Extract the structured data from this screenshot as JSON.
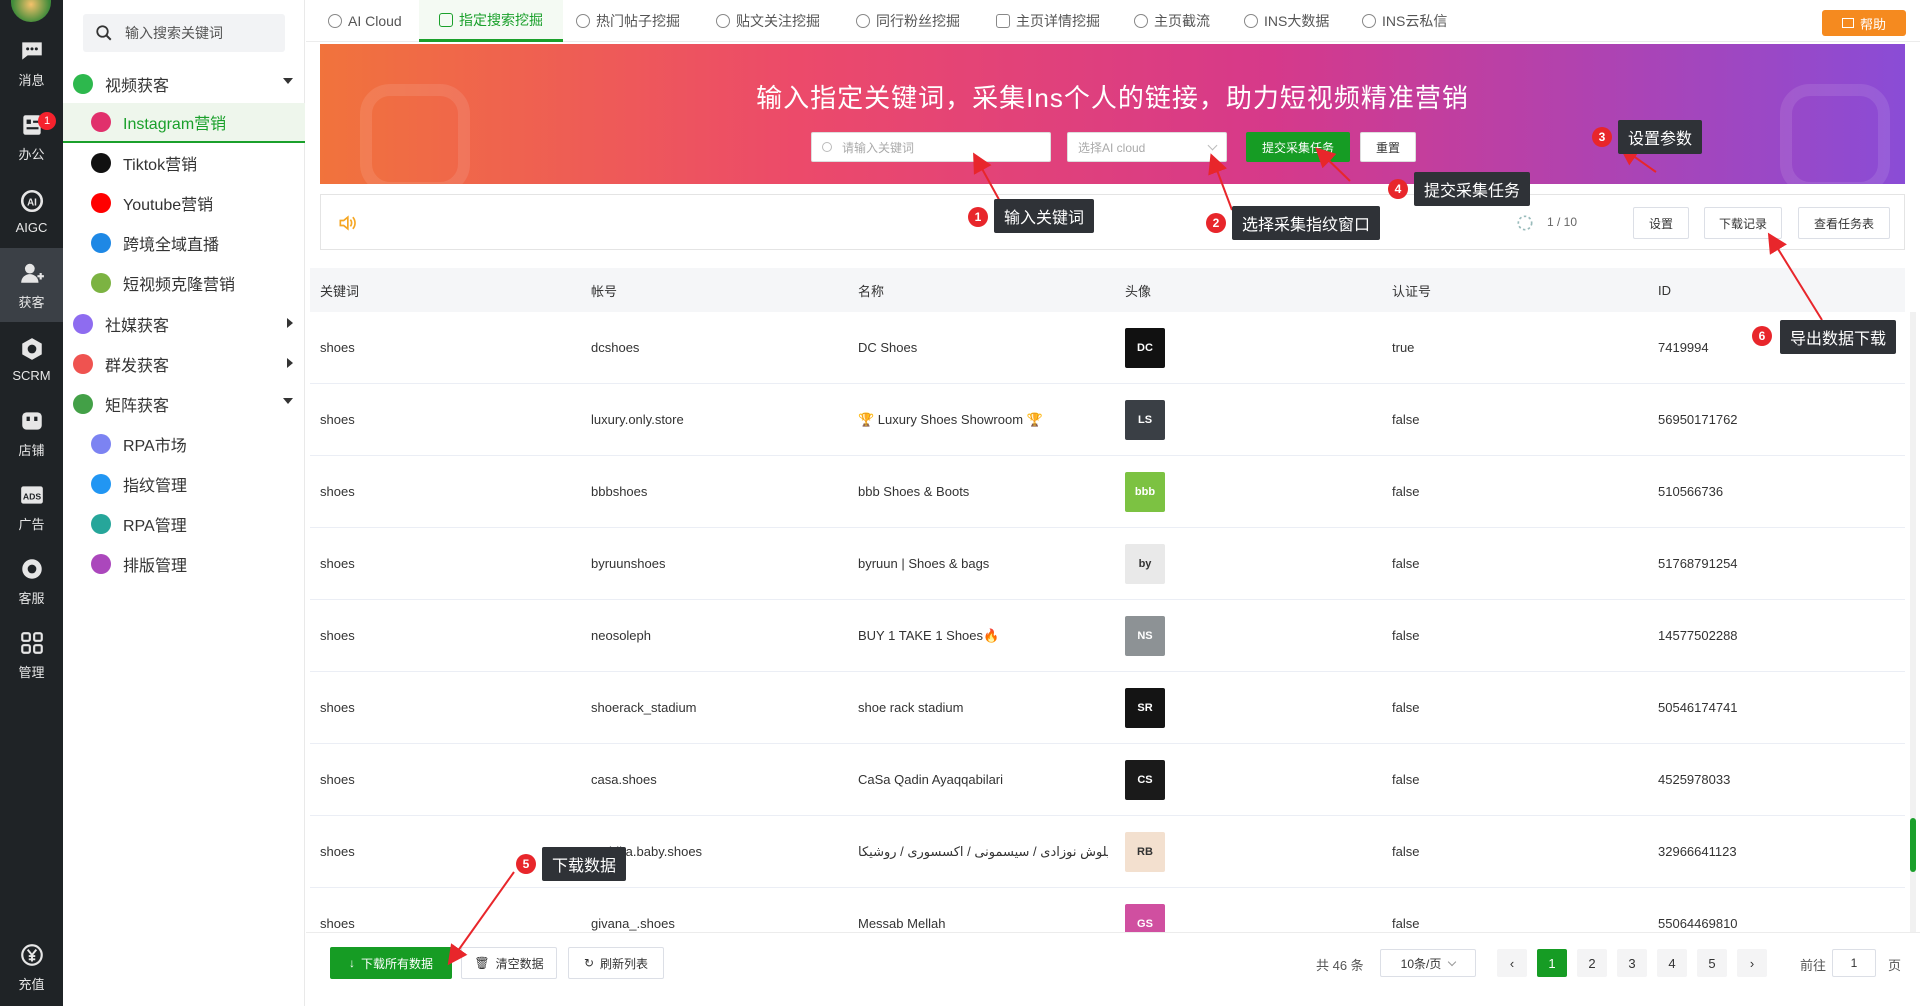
{
  "rail": {
    "items": [
      {
        "label": "消息",
        "icon": "chat-icon"
      },
      {
        "label": "办公",
        "icon": "office-icon",
        "badge": "1"
      },
      {
        "label": "AIGC",
        "icon": "ai-icon"
      },
      {
        "label": "获客",
        "icon": "user-add-icon"
      },
      {
        "label": "SCRM",
        "icon": "scrm-icon"
      },
      {
        "label": "店铺",
        "icon": "store-icon"
      },
      {
        "label": "广告",
        "icon": "ads-icon"
      },
      {
        "label": "客服",
        "icon": "service-icon"
      },
      {
        "label": "管理",
        "icon": "grid-icon"
      }
    ],
    "recharge": "充值"
  },
  "sidebar": {
    "search_placeholder": "输入搜索关键词",
    "items": [
      {
        "label": "视频获客",
        "color": "#2db84d",
        "arrow": "down"
      },
      {
        "label": "Instagram营销",
        "color": "#e1306c",
        "selected": true
      },
      {
        "label": "Tiktok营销",
        "color": "#111111"
      },
      {
        "label": "Youtube营销",
        "color": "#ff0000"
      },
      {
        "label": "跨境全域直播",
        "color": "#1e88e5"
      },
      {
        "label": "短视频克隆营销",
        "color": "#7cb342"
      },
      {
        "label": "社媒获客",
        "color": "#8e6cf0",
        "arrow": "right"
      },
      {
        "label": "群发获客",
        "color": "#ef5350",
        "arrow": "right"
      },
      {
        "label": "矩阵获客",
        "color": "#43a047",
        "arrow": "down"
      },
      {
        "label": "RPA市场",
        "color": "#7c83f2"
      },
      {
        "label": "指纹管理",
        "color": "#2196f3"
      },
      {
        "label": "RPA管理",
        "color": "#26a69a"
      },
      {
        "label": "排版管理",
        "color": "#ab47bc"
      }
    ]
  },
  "tabs": [
    "AI Cloud",
    "指定搜索挖掘",
    "热门帖子挖掘",
    "贴文关注挖掘",
    "同行粉丝挖掘",
    "主页详情挖掘",
    "主页截流",
    "INS大数据",
    "INS云私信"
  ],
  "help_label": "帮助",
  "banner": {
    "title": "输入指定关键词，采集Ins个人的链接，助力短视频精准营销",
    "keyword_placeholder": "请输入关键词",
    "select_placeholder": "选择AI cloud",
    "submit_label": "提交采集任务",
    "reset_label": "重置"
  },
  "taskbar": {
    "progress": "1 / 10",
    "settings_label": "设置",
    "download_log_label": "下载记录",
    "view_tasks_label": "查看任务表"
  },
  "table": {
    "headers": [
      "关键词",
      "帐号",
      "名称",
      "头像",
      "认证号",
      "ID"
    ],
    "rows": [
      {
        "keyword": "shoes",
        "account": "dcshoes",
        "name": "DC Shoes",
        "avatar": "DC",
        "avatar_color": "#111111",
        "verified": "true",
        "id": "7419994"
      },
      {
        "keyword": "shoes",
        "account": "luxury.only.store",
        "name": "🏆 Luxury Shoes Showroom 🏆",
        "avatar": "LS",
        "avatar_color": "#3a3f45",
        "verified": "false",
        "id": "56950171762"
      },
      {
        "keyword": "shoes",
        "account": "bbbshoes",
        "name": "bbb Shoes & Boots",
        "avatar": "bbb",
        "avatar_color": "#7cc242",
        "verified": "false",
        "id": "510566736"
      },
      {
        "keyword": "shoes",
        "account": "byruunshoes",
        "name": "byruun | Shoes & bags",
        "avatar": "by",
        "avatar_color": "#e9e9e9",
        "verified": "false",
        "id": "51768791254"
      },
      {
        "keyword": "shoes",
        "account": "neosoleph",
        "name": "BUY 1 TAKE 1 Shoes🔥",
        "avatar": "NS",
        "avatar_color": "#8d9295",
        "verified": "false",
        "id": "14577502288"
      },
      {
        "keyword": "shoes",
        "account": "shoerack_stadium",
        "name": "shoe rack stadium",
        "avatar": "SR",
        "avatar_color": "#141414",
        "verified": "false",
        "id": "50546174741"
      },
      {
        "keyword": "shoes",
        "account": "casa.shoes",
        "name": "CaSa Qadin Ayaqqabilari",
        "avatar": "CS",
        "avatar_color": "#1a1a1a",
        "verified": "false",
        "id": "4525978033"
      },
      {
        "keyword": "shoes",
        "account": "roshika.baby.shoes",
        "name": "يلوش نوزادی / سیسمونی / اکسسوری / روشیکا / ...",
        "avatar": "RB",
        "avatar_color": "#f3e0cf",
        "verified": "false",
        "id": "32966641123"
      },
      {
        "keyword": "shoes",
        "account": "givana_.shoes",
        "name": "Messab Mellah",
        "avatar": "GS",
        "avatar_color": "#d04fa0",
        "verified": "false",
        "id": "55064469810"
      }
    ]
  },
  "footer": {
    "download_all_label": "下载所有数据",
    "clear_label": "清空数据",
    "refresh_label": "刷新列表",
    "total": "共 46 条",
    "page_size": "10条/页",
    "pages": [
      "1",
      "2",
      "3",
      "4",
      "5"
    ],
    "current_page": "1",
    "goto_label": "前往",
    "goto_value": "1",
    "page_suffix": "页"
  },
  "callouts": [
    {
      "num": "1",
      "label": "输入关键词"
    },
    {
      "num": "2",
      "label": "选择采集指纹窗口"
    },
    {
      "num": "3",
      "label": "设置参数"
    },
    {
      "num": "4",
      "label": "提交采集任务"
    },
    {
      "num": "5",
      "label": "下载数据"
    },
    {
      "num": "6",
      "label": "导出数据下载"
    }
  ]
}
